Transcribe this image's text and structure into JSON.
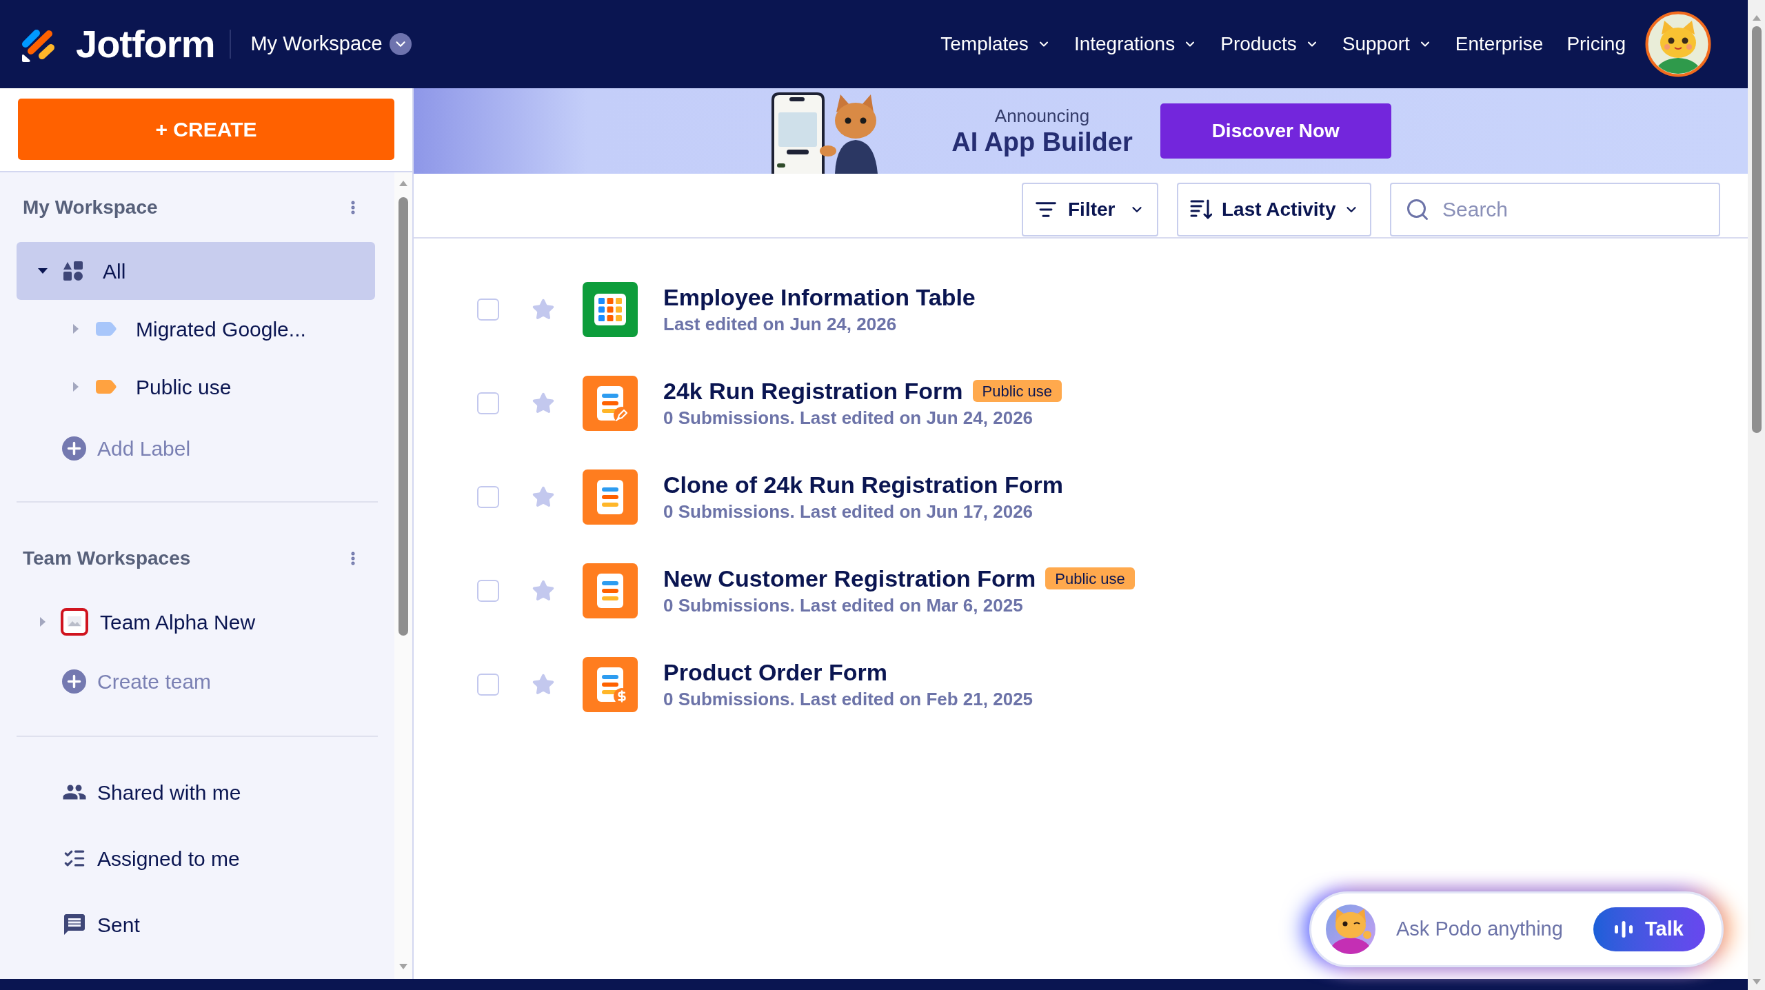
{
  "header": {
    "brand": "Jotform",
    "workspace_menu": "My Workspace",
    "nav": [
      {
        "label": "Templates",
        "has_menu": true
      },
      {
        "label": "Integrations",
        "has_menu": true
      },
      {
        "label": "Products",
        "has_menu": true
      },
      {
        "label": "Support",
        "has_menu": true
      },
      {
        "label": "Enterprise",
        "has_menu": false
      },
      {
        "label": "Pricing",
        "has_menu": false
      }
    ]
  },
  "sidebar": {
    "create_button": "+ CREATE",
    "my_workspace": {
      "title": "My Workspace",
      "tree": [
        {
          "label": "All",
          "kind": "all",
          "expanded": true,
          "selected": true,
          "children": [
            {
              "label": "Migrated Google...",
              "kind": "label",
              "color": "#a8c6fa",
              "expanded": false,
              "selected": false
            },
            {
              "label": "Public use",
              "kind": "label",
              "color": "#ffa240",
              "expanded": false,
              "selected": false
            }
          ]
        }
      ],
      "add_action": "Add Label"
    },
    "team_workspaces": {
      "title": "Team Workspaces",
      "teams": [
        {
          "label": "Team Alpha New",
          "expanded": false,
          "selected": false
        }
      ],
      "add_action": "Create team"
    },
    "links": [
      {
        "label": "Shared with me",
        "kind": "shared",
        "selected": false
      },
      {
        "label": "Assigned to me",
        "kind": "assigned",
        "selected": false
      },
      {
        "label": "Sent",
        "kind": "sent",
        "selected": false
      }
    ]
  },
  "banner": {
    "eyebrow": "Announcing",
    "title": "AI App Builder",
    "button": "Discover Now"
  },
  "toolbar": {
    "filter": "Filter",
    "sort": "Last Activity",
    "search": {
      "placeholder": "Search"
    }
  },
  "forms": [
    {
      "kind": "table",
      "title": "Employee Information Table",
      "meta": "Last edited on Jun 24, 2026",
      "checked": false,
      "starred": false
    },
    {
      "kind": "signature_form",
      "title": "24k Run Registration Form",
      "tag": "Public use",
      "meta": "0 Submissions. Last edited on Jun 24, 2026",
      "checked": false,
      "starred": false
    },
    {
      "kind": "form",
      "title": "Clone of 24k Run Registration Form",
      "meta": "0 Submissions. Last edited on Jun 17, 2026",
      "checked": false,
      "starred": false
    },
    {
      "kind": "form",
      "title": "New Customer Registration Form",
      "tag": "Public use",
      "meta": "0 Submissions. Last edited on Mar 6, 2025",
      "checked": false,
      "starred": false
    },
    {
      "kind": "payment_form",
      "title": "Product Order Form",
      "meta": "0 Submissions. Last edited on Feb 21, 2025",
      "checked": false,
      "starred": false
    }
  ],
  "assistant": {
    "prompt": "Ask Podo anything",
    "button": "Talk"
  }
}
